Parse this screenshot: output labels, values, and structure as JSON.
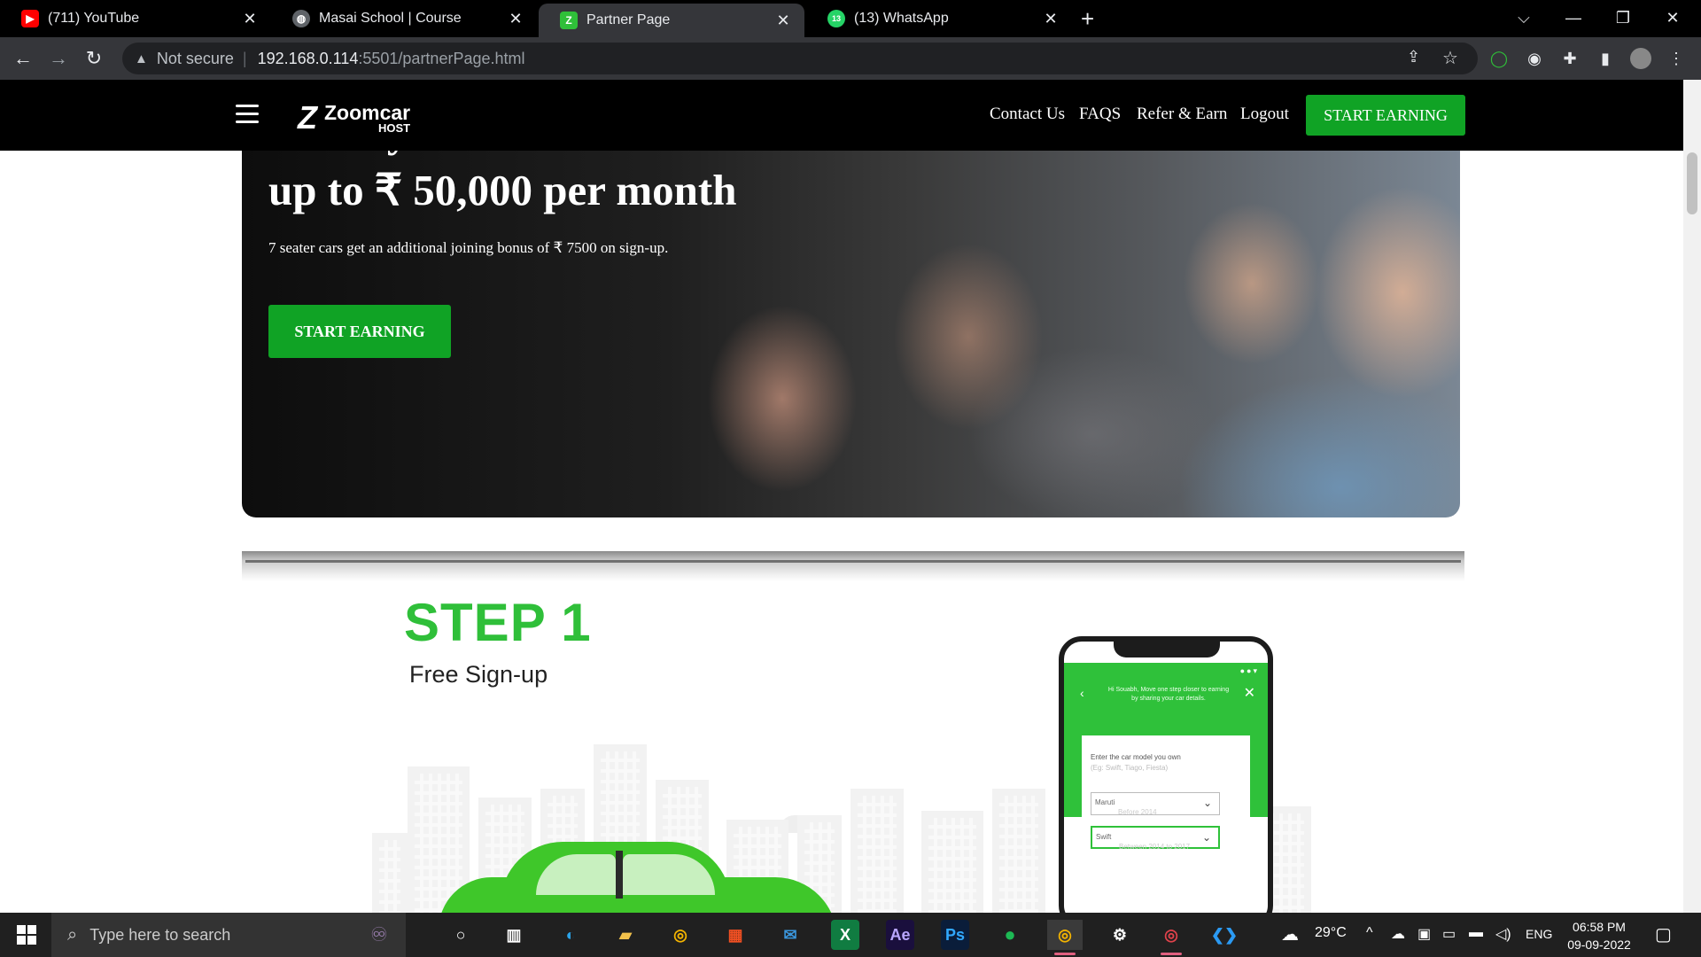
{
  "browser": {
    "tabs": [
      {
        "title": "(711) YouTube",
        "favicon": "youtube-icon",
        "color": "#ff0000"
      },
      {
        "title": "Masai School | Course",
        "favicon": "globe-icon",
        "color": "#9aa0a6"
      },
      {
        "title": "Partner Page",
        "favicon": "zoomcar-icon",
        "color": "#2fbf39"
      },
      {
        "title": "(13) WhatsApp",
        "favicon": "whatsapp-icon",
        "color": "#25d366",
        "badge": "13"
      }
    ],
    "new_tab": "+",
    "address": {
      "security": "Not secure",
      "host": "192.168.0.114",
      "path": ":5501/partnerPage.html"
    }
  },
  "site": {
    "brand": "Zoomcar",
    "brand_sub": "HOST",
    "nav": [
      "Contact Us",
      "FAQS",
      "Refer & Earn",
      "Logout"
    ],
    "nav_cta": "START EARNING",
    "accent": "#10a325"
  },
  "hero": {
    "title_line1": "Share your car and earn",
    "title_line2": "up to ₹ 50,000 per month",
    "subtitle": "7 seater cars get an additional joining bonus of ₹ 7500 on sign-up.",
    "cta": "START EARNING"
  },
  "step": {
    "title": "STEP 1",
    "subtitle": "Free Sign-up",
    "phone": {
      "message": "Hi Souabh, Move one step closer to earning by sharing your car details.",
      "question": "Enter the car model you own",
      "example": "(Eg: Swift, Tiago, Fiesta)",
      "make": "Maruti",
      "make_hint": "Before 2014",
      "model": "Swift",
      "model_hint": "Between 2014 to 2017"
    }
  },
  "taskbar": {
    "search_placeholder": "Type here to search",
    "weather": "29°C",
    "language": "ENG",
    "time": "06:58 PM",
    "date": "09-09-2022"
  }
}
